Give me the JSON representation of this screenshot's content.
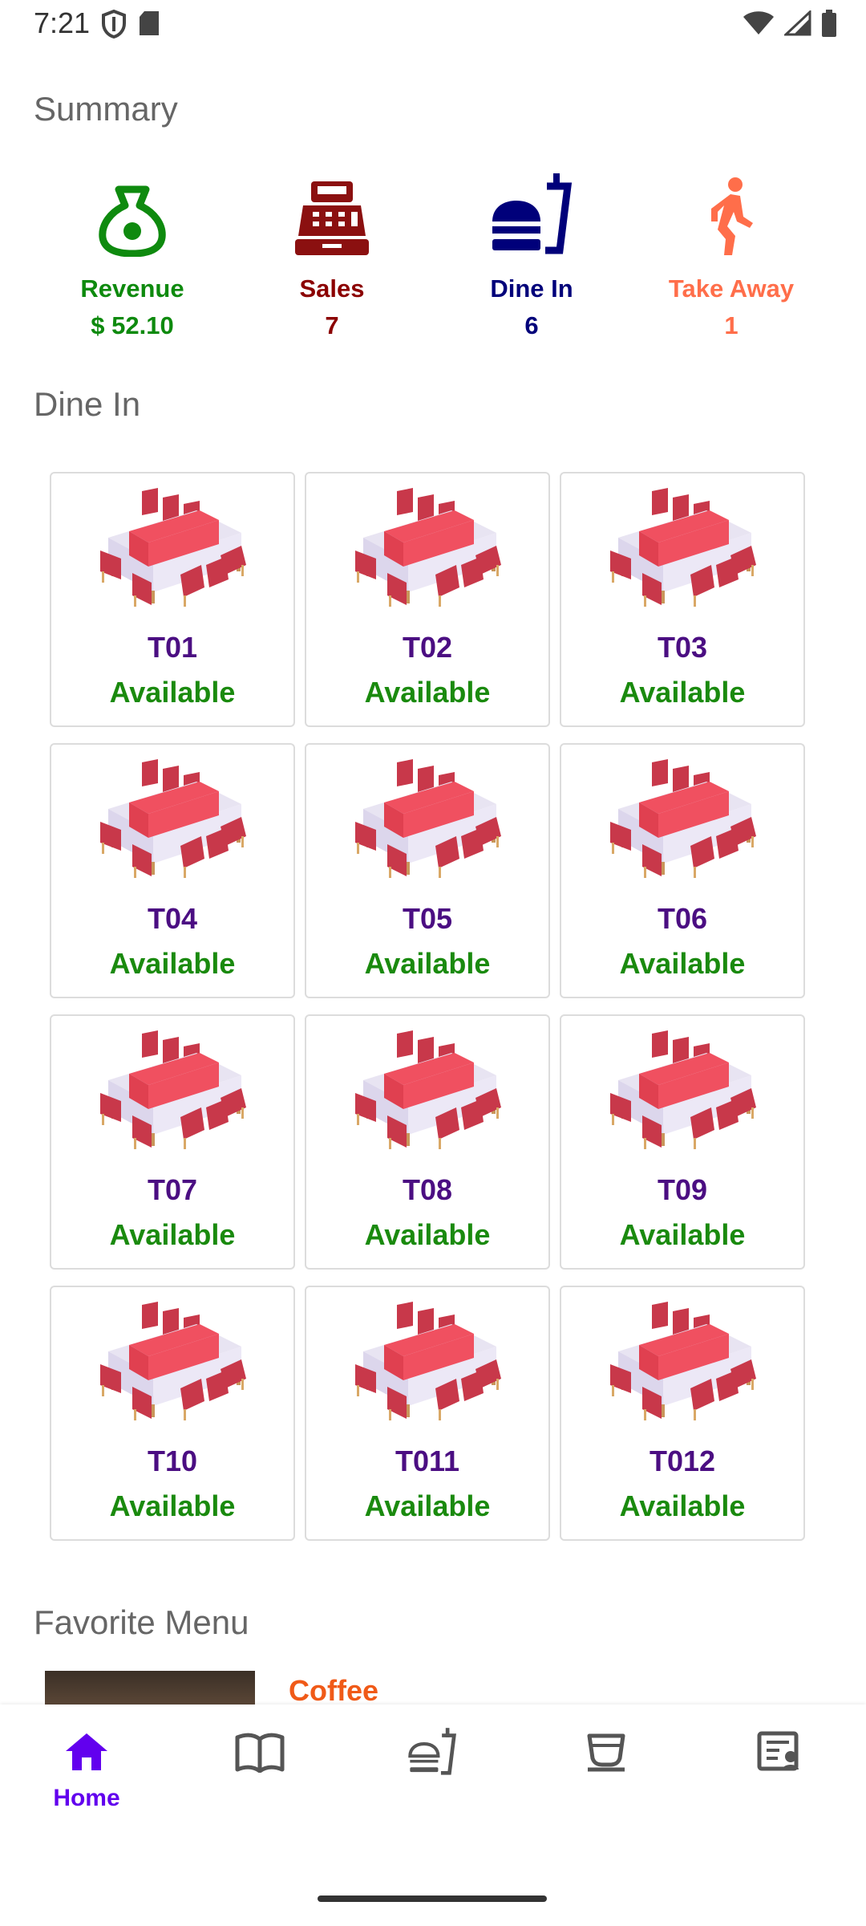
{
  "status_bar": {
    "time": "7:21"
  },
  "summary": {
    "title": "Summary",
    "items": [
      {
        "label": "Revenue",
        "value": "$ 52.10",
        "color": "#0e8a0e",
        "icon": "money-bag-icon"
      },
      {
        "label": "Sales",
        "value": "7",
        "color": "#8b0000",
        "icon": "cash-register-icon"
      },
      {
        "label": "Dine In",
        "value": "6",
        "color": "#00007a",
        "icon": "dine-in-icon"
      },
      {
        "label": "Take Away",
        "value": "1",
        "color": "#ff6e4a",
        "icon": "walking-person-icon"
      }
    ]
  },
  "dine_in": {
    "title": "Dine In",
    "tables": [
      {
        "name": "T01",
        "status": "Available"
      },
      {
        "name": "T02",
        "status": "Available"
      },
      {
        "name": "T03",
        "status": "Available"
      },
      {
        "name": "T04",
        "status": "Available"
      },
      {
        "name": "T05",
        "status": "Available"
      },
      {
        "name": "T06",
        "status": "Available"
      },
      {
        "name": "T07",
        "status": "Available"
      },
      {
        "name": "T08",
        "status": "Available"
      },
      {
        "name": "T09",
        "status": "Available"
      },
      {
        "name": "T10",
        "status": "Available"
      },
      {
        "name": "T011",
        "status": "Available"
      },
      {
        "name": "T012",
        "status": "Available"
      }
    ]
  },
  "favorite_menu": {
    "title": "Favorite Menu",
    "items": [
      {
        "name": "Coffee"
      }
    ]
  },
  "bottom_nav": {
    "items": [
      {
        "label": "Home",
        "icon": "home-icon",
        "active": true
      },
      {
        "label": "",
        "icon": "menu-book-icon",
        "active": false
      },
      {
        "label": "",
        "icon": "dine-in-icon",
        "active": false
      },
      {
        "label": "",
        "icon": "coffee-cup-icon",
        "active": false
      },
      {
        "label": "",
        "icon": "report-icon",
        "active": false
      }
    ]
  }
}
